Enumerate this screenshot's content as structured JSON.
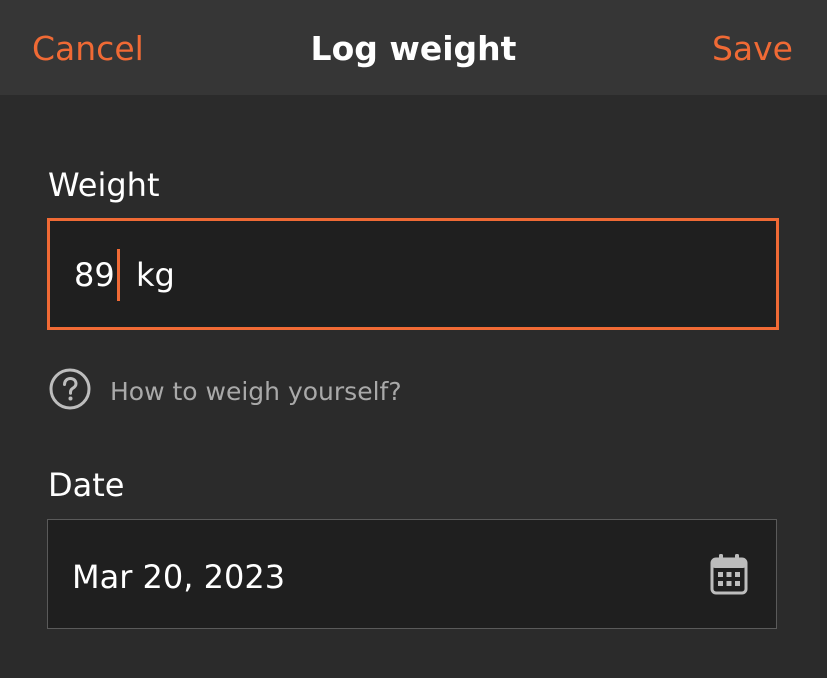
{
  "header": {
    "cancel_label": "Cancel",
    "title": "Log weight",
    "save_label": "Save"
  },
  "weight": {
    "label": "Weight",
    "value": "89",
    "unit": "kg"
  },
  "help": {
    "icon": "question-circle-icon",
    "text": "How to weigh yourself?"
  },
  "date": {
    "label": "Date",
    "value": "Mar 20, 2023",
    "icon": "calendar-icon"
  },
  "colors": {
    "accent": "#f06a35",
    "background": "#2b2b2b",
    "header_background": "#363636",
    "field_background": "#1f1f1f"
  }
}
